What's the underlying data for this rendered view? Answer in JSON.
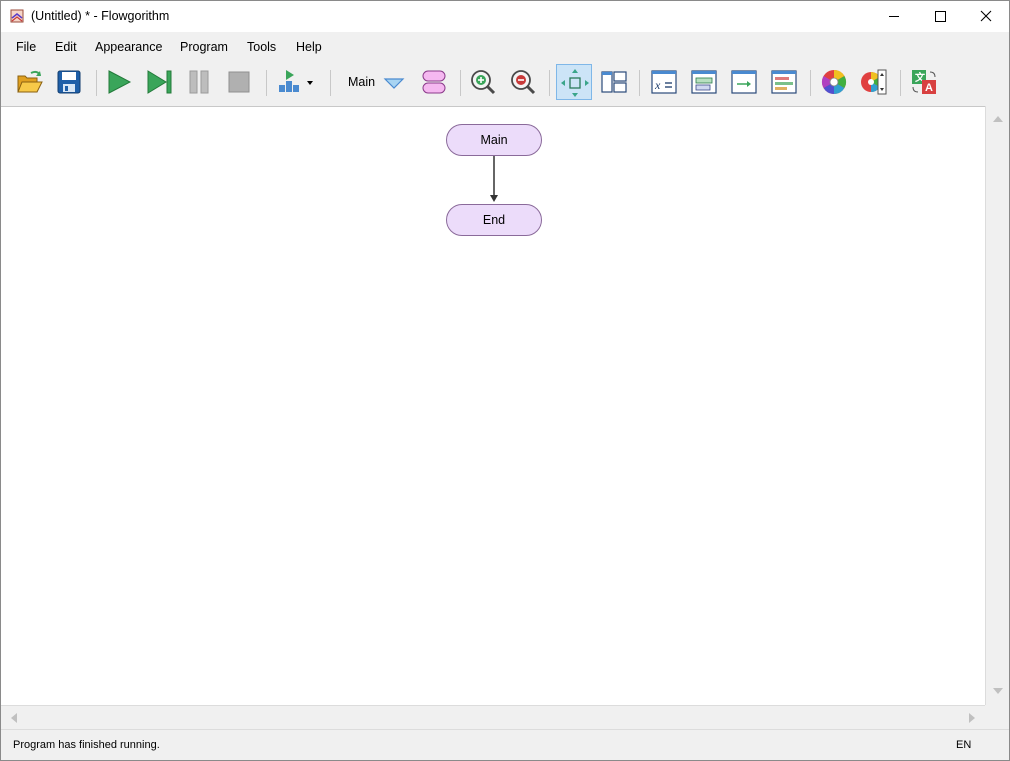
{
  "window": {
    "title": "(Untitled) * - Flowgorithm",
    "minimize_icon": "minimize-icon",
    "maximize_icon": "maximize-icon",
    "close_icon": "close-icon"
  },
  "menu": {
    "items": [
      "File",
      "Edit",
      "Appearance",
      "Program",
      "Tools",
      "Help"
    ]
  },
  "toolbar": {
    "function_selector_label": "Main",
    "buttons": [
      {
        "icon": "open-folder-icon"
      },
      {
        "icon": "save-disk-icon"
      },
      {
        "icon": "run-icon"
      },
      {
        "icon": "step-icon"
      },
      {
        "icon": "pause-icon"
      },
      {
        "icon": "stop-icon"
      },
      {
        "icon": "run-speed-icon"
      },
      {
        "icon": "function-dropdown-icon"
      },
      {
        "icon": "manage-functions-icon"
      },
      {
        "icon": "zoom-in-icon"
      },
      {
        "icon": "zoom-out-icon"
      },
      {
        "icon": "center-chart-icon",
        "active": true
      },
      {
        "icon": "layout-windows-icon"
      },
      {
        "icon": "variable-watch-icon"
      },
      {
        "icon": "source-code-icon"
      },
      {
        "icon": "console-icon"
      },
      {
        "icon": "layout-icon"
      },
      {
        "icon": "color-scheme-icon"
      },
      {
        "icon": "chart-style-icon"
      },
      {
        "icon": "translate-language-icon"
      }
    ]
  },
  "flowchart": {
    "start_label": "Main",
    "end_label": "End"
  },
  "status": {
    "message": "Program has finished running.",
    "language": "EN"
  },
  "colors": {
    "terminal_fill": "#ecdcfa",
    "terminal_border": "#8a6a9a",
    "run_green": "#3aa55a",
    "active_button": "#cce4f7"
  }
}
